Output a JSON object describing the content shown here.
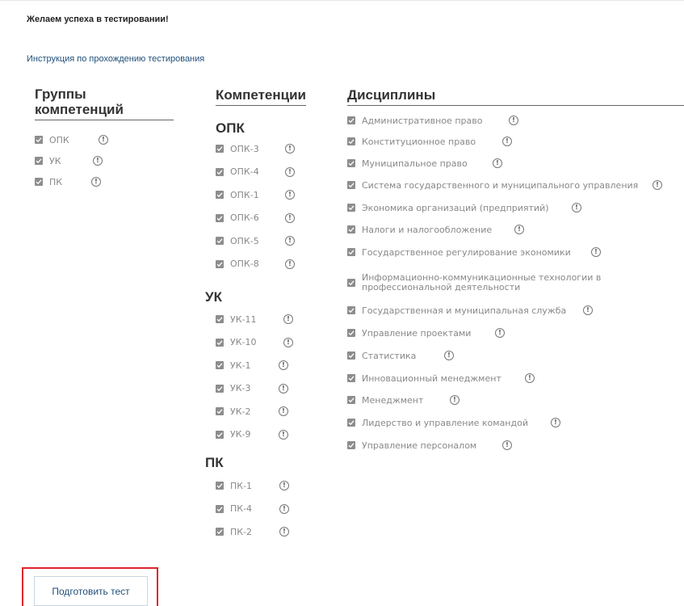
{
  "header": {
    "greeting": "Желаем успеха в тестировании!",
    "instruction_link": "Инструкция по прохождению тестирования"
  },
  "columns": {
    "groups_title": "Группы компетенций",
    "competencies_title": "Компетенции",
    "disciplines_title": "Дисциплины"
  },
  "competency_groups": [
    {
      "label": "ОПК",
      "checked": true
    },
    {
      "label": "УК",
      "checked": true
    },
    {
      "label": "ПК",
      "checked": true
    }
  ],
  "competencies": {
    "opk": {
      "title": "ОПК",
      "items": [
        "ОПК-3",
        "ОПК-4",
        "ОПК-1",
        "ОПК-6",
        "ОПК-5",
        "ОПК-8"
      ]
    },
    "uk": {
      "title": "УК",
      "items": [
        "УК-11",
        "УК-10",
        "УК-1",
        "УК-3",
        "УК-2",
        "УК-9"
      ]
    },
    "pk": {
      "title": "ПК",
      "items": [
        "ПК-1",
        "ПК-4",
        "ПК-2"
      ]
    }
  },
  "disciplines": [
    "Административное право",
    "Конституционное право",
    "Муниципальное право",
    "Система государственного и муниципального управления",
    "Экономика организаций (предприятий)",
    "Налоги и налогообложение",
    "Государственное регулирование экономики",
    "Информационно-коммуникационные технологии в профессиональной деятельности",
    "Государственная и муниципальная служба",
    "Управление проектами",
    "Статистика",
    "Инновационный менеджмент",
    "Менеджмент",
    "Лидерство и управление командой",
    "Управление персоналом"
  ],
  "info_glyph": "!",
  "colors": {
    "checkbox": "#8d8d8d",
    "link": "#1f4f7a",
    "highlight_border": "#e0242c"
  },
  "actions": {
    "prepare_test": "Подготовить тест"
  }
}
